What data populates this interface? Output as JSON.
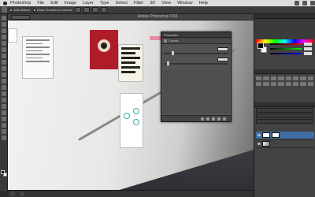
{
  "menubar": {
    "items": [
      "Photoshop",
      "File",
      "Edit",
      "Image",
      "Layer",
      "Type",
      "Select",
      "Filter",
      "3D",
      "View",
      "Window",
      "Help"
    ]
  },
  "options_bar": {
    "auto_select_label": "Auto-Select:",
    "transform_controls_label": "Show Transform Controls"
  },
  "document": {
    "title": "Adobe Photoshop CS6"
  },
  "dialog": {
    "title": "Properties",
    "tab_label": "Curves"
  },
  "colors": {
    "accent": "#3f6ea6",
    "poster_red": "#b01b2a",
    "ui_dark": "#3b3b3b"
  }
}
